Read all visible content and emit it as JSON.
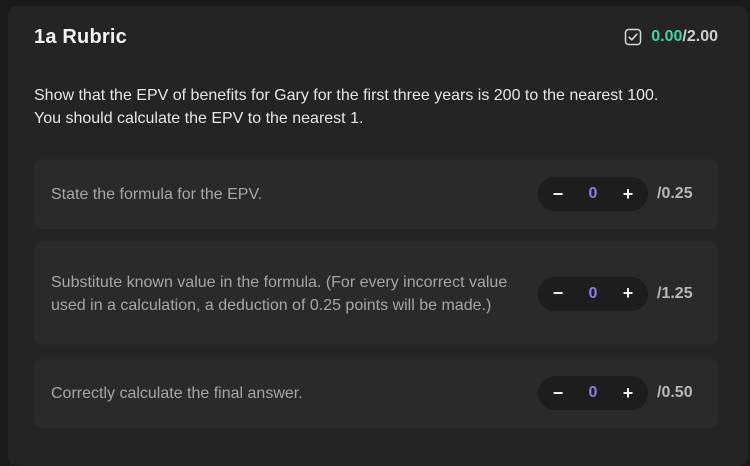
{
  "rubric": {
    "title": "1a Rubric",
    "score_earned": "0.00",
    "score_max": "/2.00",
    "description_line1": "Show that the EPV of benefits for Gary for the first three years is 200 to the nearest 100.",
    "description_line2": "You should calculate the EPV to the nearest 1."
  },
  "criteria": [
    {
      "text": "State the formula for the EPV.",
      "value": "0",
      "max": "/0.25"
    },
    {
      "text": "Substitute known value in the formula. (For every incorrect value used in a calculation, a deduction of 0.25 points will be made.)",
      "value": "0",
      "max": "/1.25"
    },
    {
      "text": "Correctly calculate the final answer.",
      "value": "0",
      "max": "/0.50"
    }
  ],
  "controls": {
    "decrement_symbol": "−",
    "increment_symbol": "+"
  },
  "colors": {
    "earned": "#3fd6a0",
    "stepper_value": "#8b7fe0"
  },
  "icons": {
    "score_icon": "checkbox-checked-icon"
  }
}
